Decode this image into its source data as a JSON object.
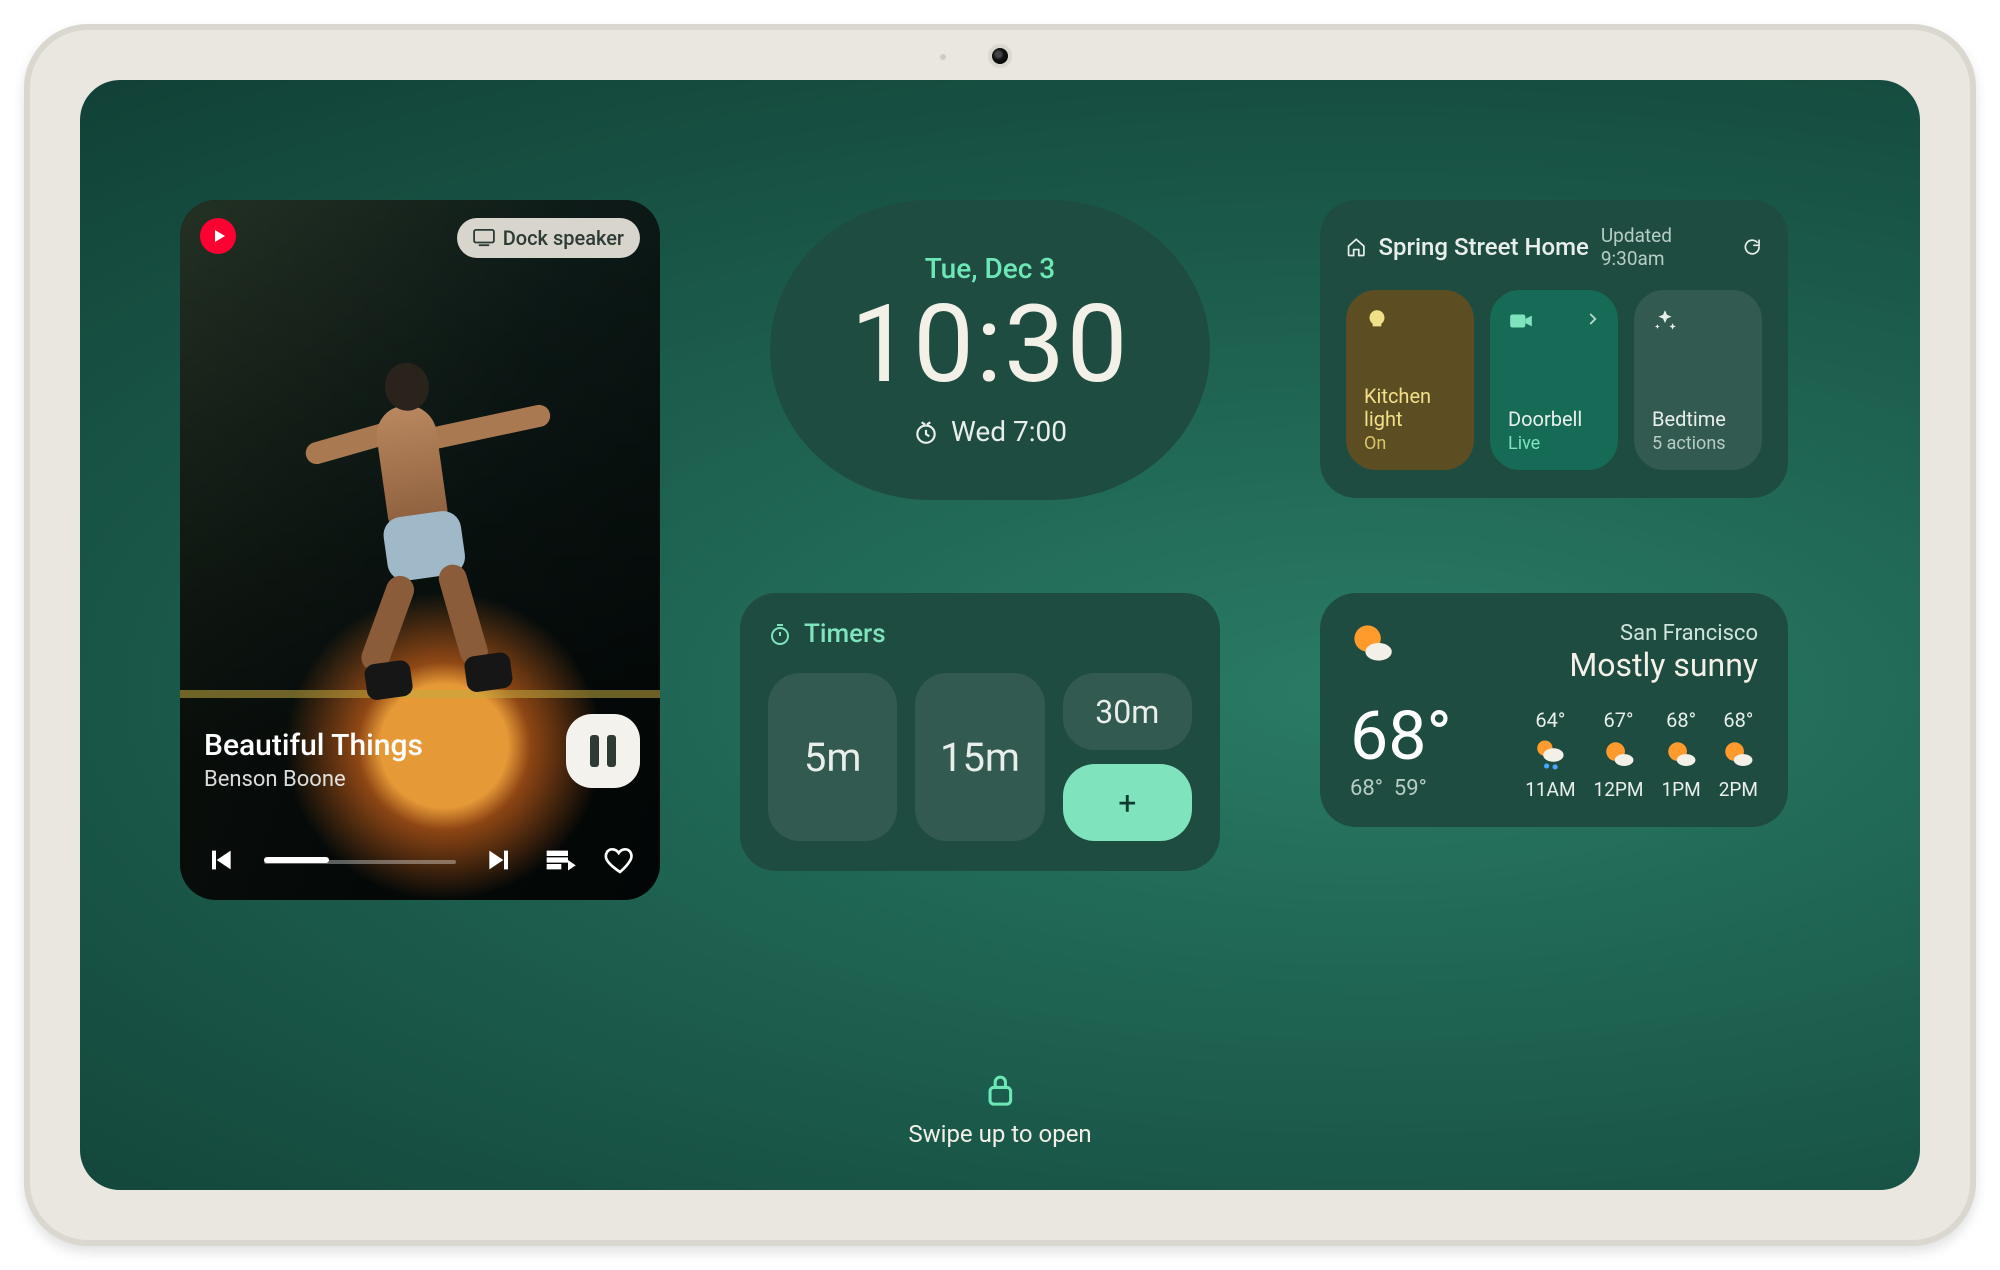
{
  "media": {
    "source_icon": "youtube-music-icon",
    "cast_label": "Dock speaker",
    "track_title": "Beautiful Things",
    "track_artist": "Benson Boone",
    "playing": true
  },
  "clock": {
    "date": "Tue, Dec 3",
    "time": "10:30",
    "alarm_label": "Wed 7:00"
  },
  "home": {
    "name": "Spring Street Home",
    "updated_label": "Updated 9:30am",
    "tiles": [
      {
        "label": "Kitchen light",
        "status": "On",
        "icon": "bulb-icon",
        "kind": "light"
      },
      {
        "label": "Doorbell",
        "status": "Live",
        "icon": "camera-icon",
        "kind": "doorbell"
      },
      {
        "label": "Bedtime",
        "status": "5 actions",
        "icon": "sparkle-icon",
        "kind": "bedtime"
      }
    ]
  },
  "timers": {
    "title": "Timers",
    "presets": [
      "5m",
      "15m",
      "30m"
    ]
  },
  "weather": {
    "city": "San Francisco",
    "condition": "Mostly sunny",
    "temp": "68°",
    "high": "68°",
    "low": "59°",
    "forecast": [
      {
        "temp": "64°",
        "time": "11AM",
        "icon": "rain"
      },
      {
        "temp": "67°",
        "time": "12PM",
        "icon": "sun"
      },
      {
        "temp": "68°",
        "time": "1PM",
        "icon": "sun"
      },
      {
        "temp": "68°",
        "time": "2PM",
        "icon": "sun"
      }
    ]
  },
  "lock": {
    "hint": "Swipe up to open"
  }
}
